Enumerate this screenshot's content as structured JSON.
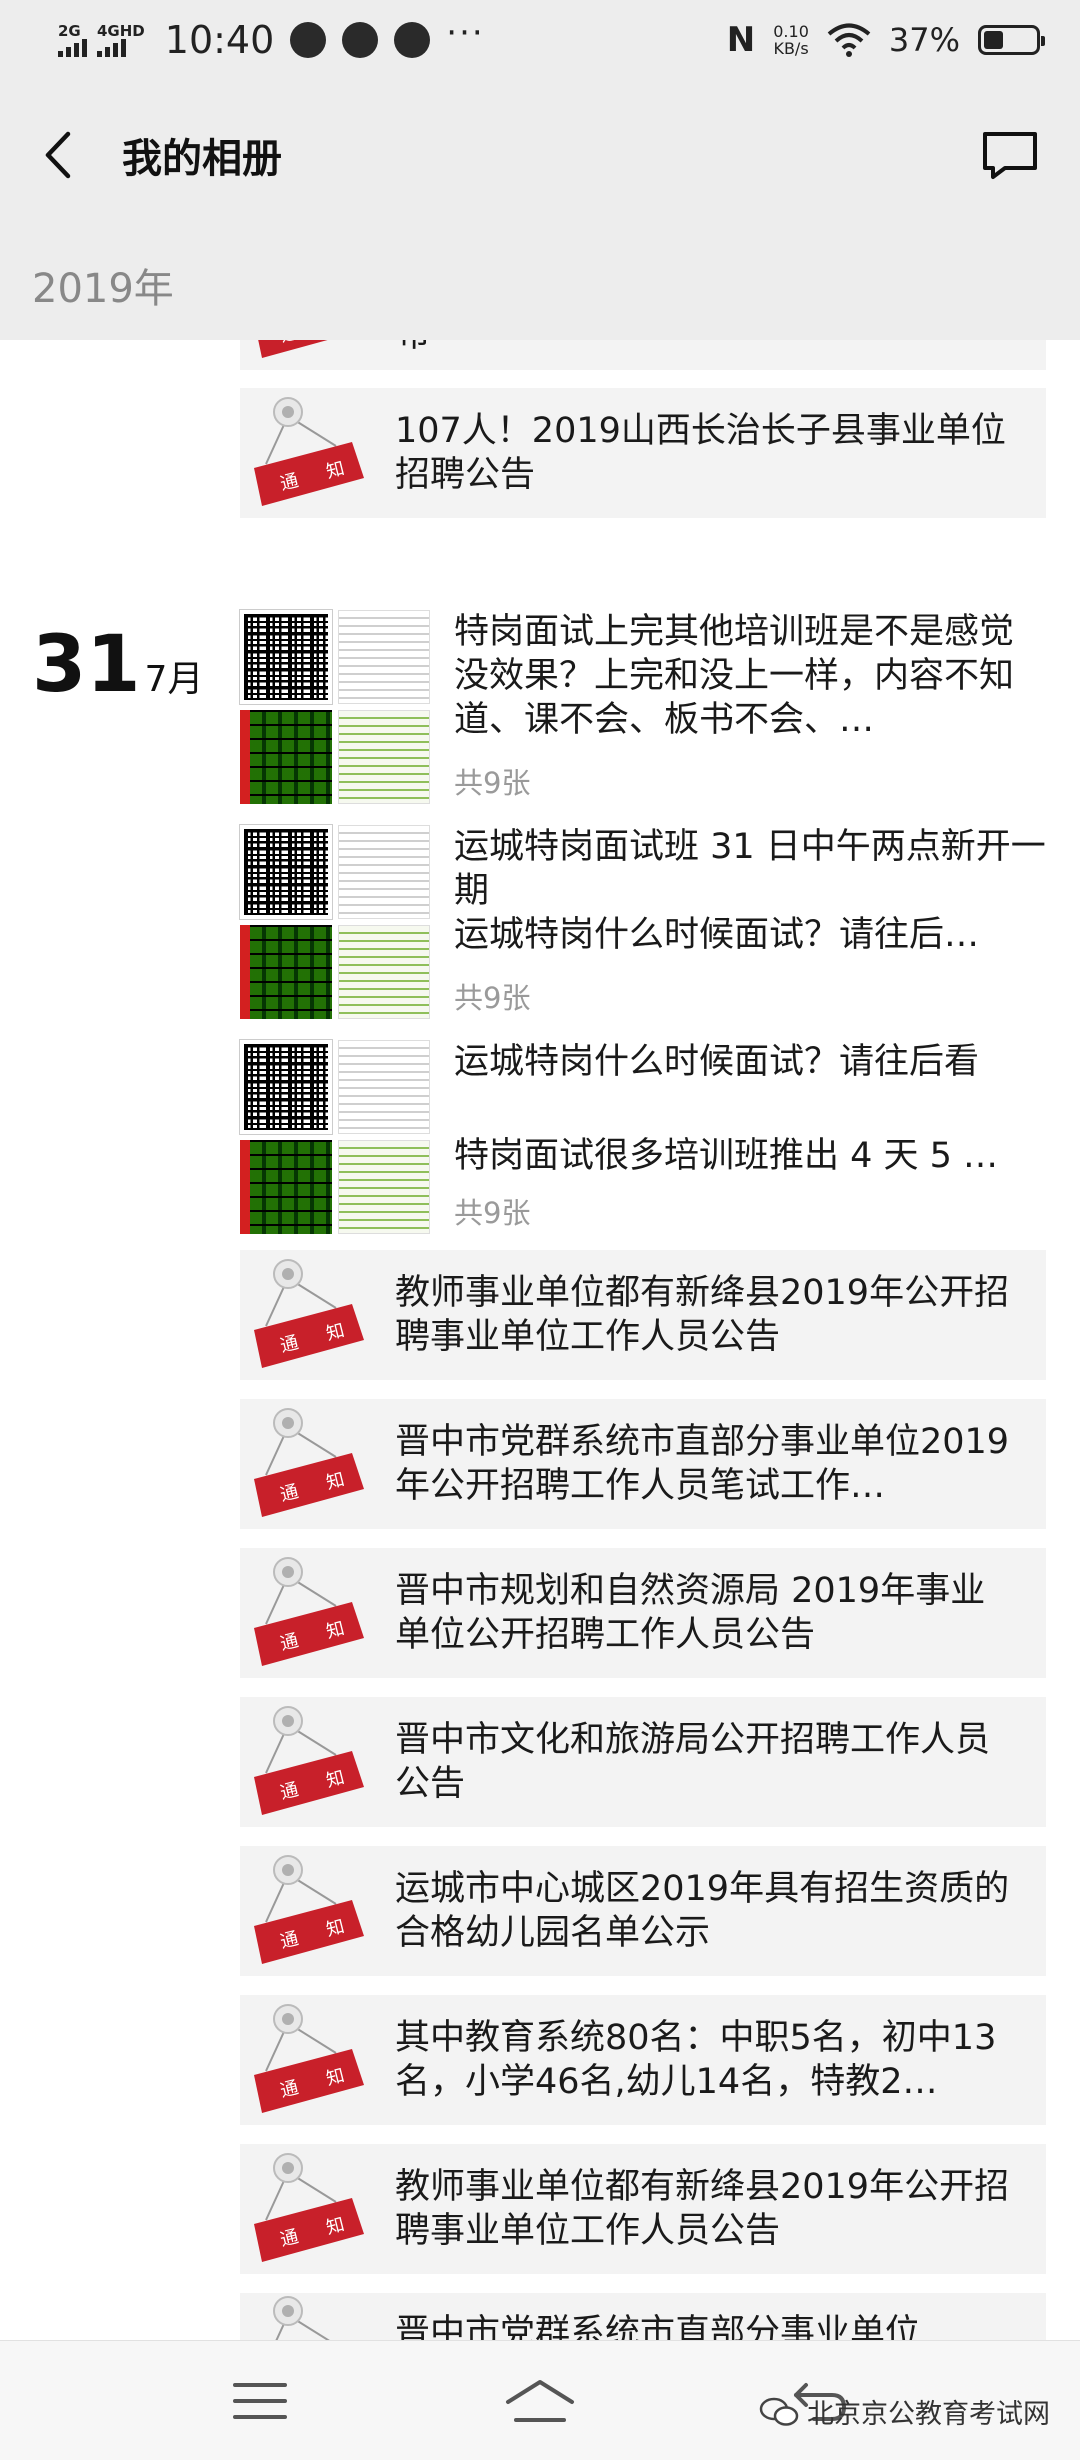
{
  "status_bar": {
    "network_left": "2G",
    "network_right": "4GHD",
    "time": "10:40",
    "nfc": "N",
    "speed_value": "0.10",
    "speed_unit": "KB/s",
    "battery_percent": "37%",
    "battery_level": 0.37
  },
  "header": {
    "title": "我的相册",
    "back_icon": "chevron-left-icon",
    "comment_icon": "comment-icon"
  },
  "year": "2019年",
  "top_partial_notice_text": "布",
  "notice_badge": {
    "left": "通",
    "right": "知",
    "color": "#c8202a"
  },
  "first_notice": "107人！2019山西长治长子县事业单位招聘公告",
  "date": {
    "day": "31",
    "month": "7月"
  },
  "photo_posts": [
    {
      "lines": [
        "特岗面试上完其他培训班是不是感觉没效果？上完和没上一样，内容不知道、课不会、板书不会、…"
      ],
      "count": "共9张"
    },
    {
      "lines": [
        "运城特岗面试班 31 日中午两点新开一期",
        "运城特岗什么时候面试？请往后…"
      ],
      "count": "共9张"
    },
    {
      "lines": [
        "运城特岗什么时候面试？请往后看",
        "特岗面试很多培训班推出 4 天 5 …"
      ],
      "count": "共9张"
    }
  ],
  "notices": [
    "教师事业单位都有新绛县2019年公开招聘事业单位工作人员公告",
    "晋中市党群系统市直部分事业单位2019年公开招聘工作人员笔试工作…",
    "晋中市规划和自然资源局 2019年事业单位公开招聘工作人员公告",
    "晋中市文化和旅游局公开招聘工作人员公告",
    "运城市中心城区2019年具有招生资质的合格幼儿园名单公示",
    "其中教育系统80名：中职5名，初中13名，小学46名,幼儿14名，特教2…",
    "教师事业单位都有新绛县2019年公开招聘事业单位工作人员公告"
  ],
  "bottom_partial_notice_text": "晋中市党群系统市直部分事业单位",
  "bottom_nav": {
    "menu_icon": "menu-icon",
    "home_icon": "home-icon",
    "back_icon": "return-icon"
  },
  "watermark": "北京京公教育考试网"
}
